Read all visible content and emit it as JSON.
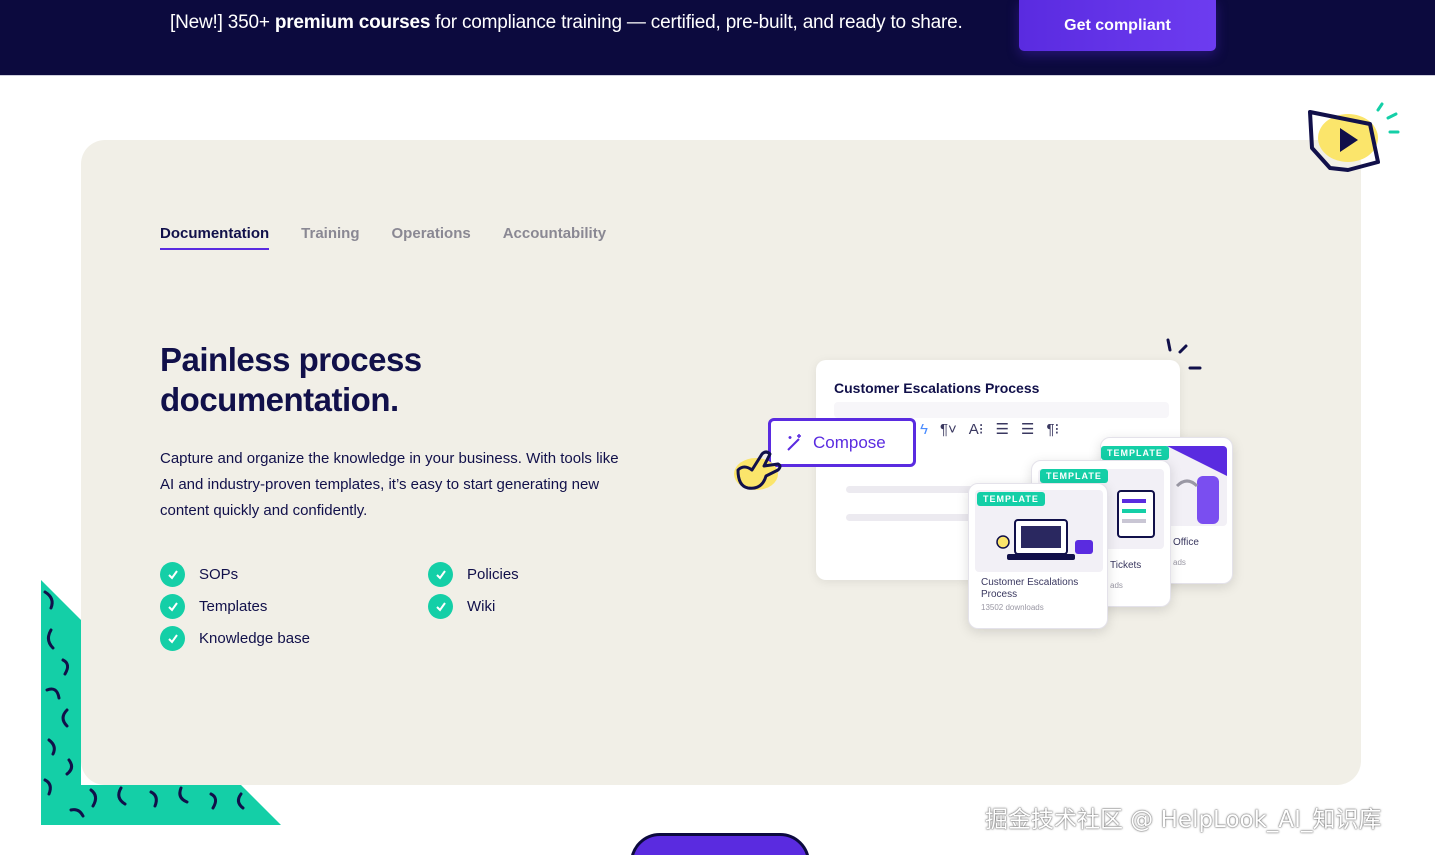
{
  "banner": {
    "prefix": "[New!] 350+ ",
    "bold": "premium courses",
    "suffix": " for compliance training — certified, pre-built, and ready to share.",
    "cta_label": "Get compliant"
  },
  "tabs": [
    {
      "label": "Documentation",
      "active": true
    },
    {
      "label": "Training",
      "active": false
    },
    {
      "label": "Operations",
      "active": false
    },
    {
      "label": "Accountability",
      "active": false
    }
  ],
  "hero": {
    "headline": "Painless process documentation.",
    "description": "Capture and organize the knowledge in your business. With tools like AI and industry-proven templates, it’s easy to start generating new content quickly and confidently."
  },
  "features": {
    "left": [
      "SOPs",
      "Templates",
      "Knowledge base"
    ],
    "right": [
      "Policies",
      "Wiki"
    ]
  },
  "illustration": {
    "doc_title": "Customer Escalations Process",
    "compose_label": "Compose",
    "cards": [
      {
        "badge": "TEMPLATE",
        "name": "Customer Escalations Process",
        "meta": "13502 downloads"
      },
      {
        "badge": "TEMPLATE",
        "name": "Tickets",
        "meta": "ads"
      },
      {
        "badge": "TEMPLATE",
        "name": "Office",
        "meta": "ads"
      }
    ]
  },
  "watermark": "掘金技术社区 @ HelpLook_AI_知识库",
  "colors": {
    "banner_bg": "#0c0a3e",
    "accent": "#5a2be0",
    "teal": "#14cfa7",
    "card_bg": "#f1efe7"
  },
  "icons": [
    "checkmark-icon",
    "magic-wand-icon",
    "pointer-hand-icon",
    "video-play-icon",
    "lightning-icon"
  ]
}
